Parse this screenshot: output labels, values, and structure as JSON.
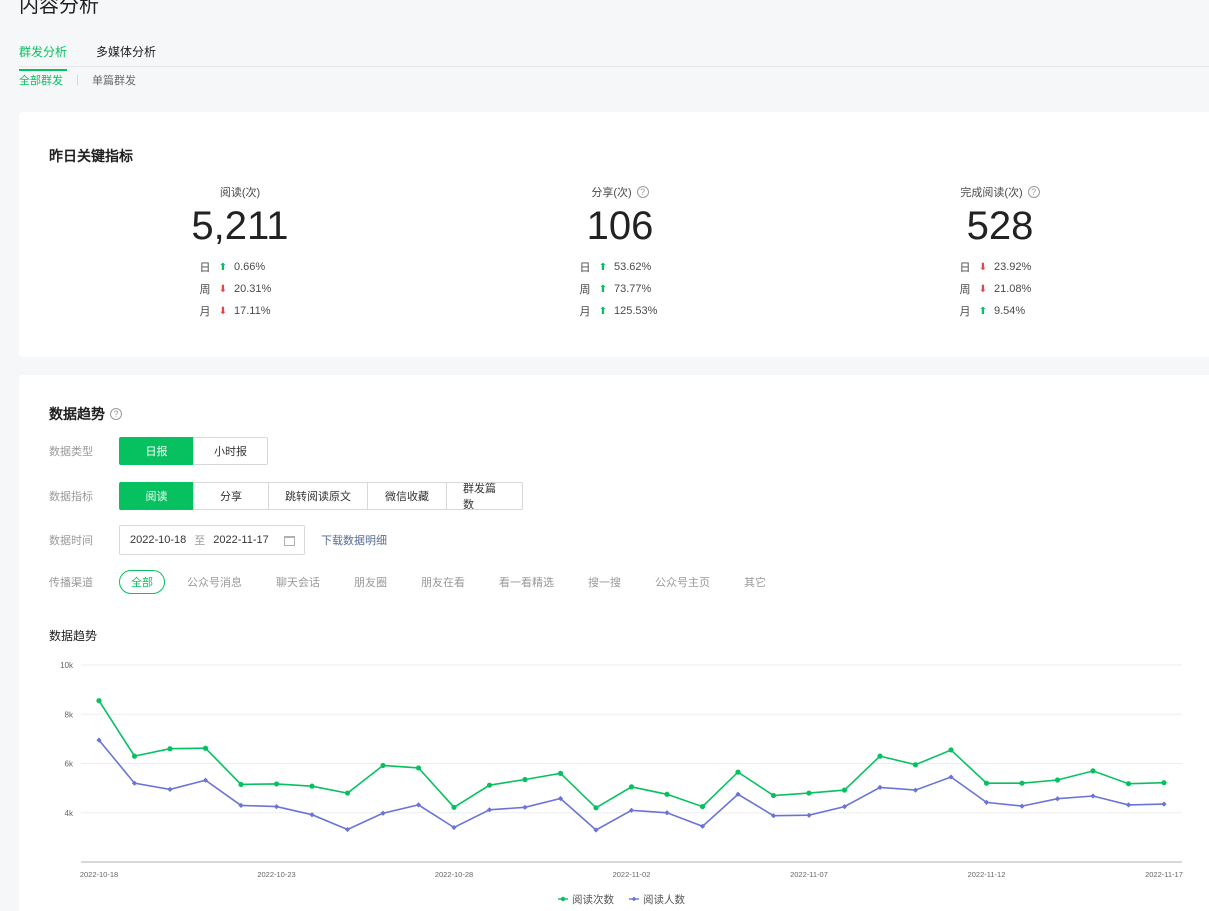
{
  "page": {
    "title": "内容分析"
  },
  "tabs": [
    {
      "label": "群发分析",
      "active": true
    },
    {
      "label": "多媒体分析",
      "active": false
    }
  ],
  "subtabs": [
    {
      "label": "全部群发",
      "active": true
    },
    {
      "label": "单篇群发",
      "active": false
    }
  ],
  "kpi": {
    "title": "昨日关键指标",
    "metrics": [
      {
        "label": "阅读(次)",
        "help": false,
        "value": "5,211",
        "rows": [
          {
            "label": "日",
            "dir": "up",
            "pct": "0.66%"
          },
          {
            "label": "周",
            "dir": "down",
            "pct": "20.31%"
          },
          {
            "label": "月",
            "dir": "down",
            "pct": "17.11%"
          }
        ]
      },
      {
        "label": "分享(次)",
        "help": true,
        "value": "106",
        "rows": [
          {
            "label": "日",
            "dir": "up",
            "pct": "53.62%"
          },
          {
            "label": "周",
            "dir": "up",
            "pct": "73.77%"
          },
          {
            "label": "月",
            "dir": "up",
            "pct": "125.53%"
          }
        ]
      },
      {
        "label": "完成阅读(次)",
        "help": true,
        "value": "528",
        "rows": [
          {
            "label": "日",
            "dir": "down",
            "pct": "23.92%"
          },
          {
            "label": "周",
            "dir": "down",
            "pct": "21.08%"
          },
          {
            "label": "月",
            "dir": "up",
            "pct": "9.54%"
          }
        ]
      }
    ]
  },
  "trend": {
    "title": "数据趋势",
    "filters": {
      "type": {
        "label": "数据类型",
        "options": [
          "日报",
          "小时报"
        ],
        "active": 0
      },
      "metric": {
        "label": "数据指标",
        "options": [
          "阅读",
          "分享",
          "跳转阅读原文",
          "微信收藏",
          "群发篇数"
        ],
        "active": 0
      },
      "time": {
        "label": "数据时间",
        "start": "2022-10-18",
        "sep": "至",
        "end": "2022-11-17",
        "download": "下载数据明细"
      },
      "channel": {
        "label": "传播渠道",
        "options": [
          "全部",
          "公众号消息",
          "聊天会话",
          "朋友圈",
          "朋友在看",
          "看一看精选",
          "搜一搜",
          "公众号主页",
          "其它"
        ],
        "active": 0
      }
    },
    "chart_title": "数据趋势"
  },
  "colors": {
    "accent": "#07c160",
    "up": "#07c160",
    "down": "#e54545",
    "series2": "#6b74d6",
    "link": "#576b95"
  },
  "chart_data": {
    "type": "line",
    "title": "数据趋势",
    "y_ticks": [
      "4k",
      "6k",
      "8k",
      "10k"
    ],
    "ylim": [
      2000,
      10000
    ],
    "x_ticks": [
      "2022-10-18",
      "2022-10-23",
      "2022-10-28",
      "2022-11-02",
      "2022-11-07",
      "2022-11-12",
      "2022-11-17"
    ],
    "x": [
      "2022-10-18",
      "2022-10-19",
      "2022-10-20",
      "2022-10-21",
      "2022-10-22",
      "2022-10-23",
      "2022-10-24",
      "2022-10-25",
      "2022-10-26",
      "2022-10-27",
      "2022-10-28",
      "2022-10-29",
      "2022-10-30",
      "2022-10-31",
      "2022-11-01",
      "2022-11-02",
      "2022-11-03",
      "2022-11-04",
      "2022-11-05",
      "2022-11-06",
      "2022-11-07",
      "2022-11-08",
      "2022-11-09",
      "2022-11-10",
      "2022-11-11",
      "2022-11-12",
      "2022-11-13",
      "2022-11-14",
      "2022-11-15",
      "2022-11-16",
      "2022-11-17"
    ],
    "series": [
      {
        "name": "阅读次数",
        "color": "#07c160",
        "marker": "circle",
        "values": [
          8550,
          6300,
          6600,
          6620,
          5150,
          5170,
          5080,
          4800,
          5920,
          5820,
          4220,
          5120,
          5350,
          5600,
          4200,
          5050,
          4750,
          4250,
          5650,
          4700,
          4800,
          4920,
          6300,
          5950,
          6550,
          5200,
          5200,
          5330,
          5700,
          5180,
          5220
        ]
      },
      {
        "name": "阅读人数",
        "color": "#6b74d6",
        "marker": "diamond",
        "values": [
          6950,
          5200,
          4950,
          5320,
          4300,
          4250,
          3920,
          3320,
          3980,
          4320,
          3400,
          4120,
          4220,
          4580,
          3300,
          4100,
          4000,
          3450,
          4750,
          3880,
          3900,
          4250,
          5030,
          4920,
          5450,
          4420,
          4270,
          4570,
          4680,
          4320,
          4350
        ]
      }
    ],
    "legend": "bottom-center"
  }
}
